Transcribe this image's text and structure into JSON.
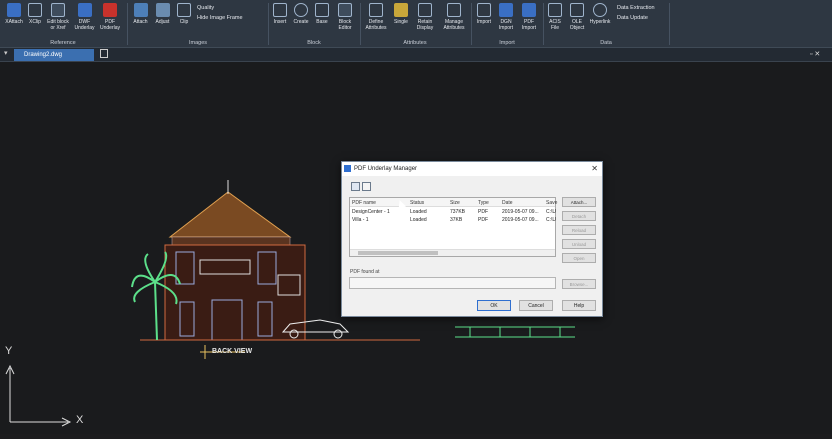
{
  "ribbon": {
    "reference": {
      "items": [
        "XAttach",
        "XClip",
        "Edit block or Xref",
        "DWF Underlay",
        "PDF Underlay"
      ],
      "label": "Reference"
    },
    "images": {
      "items": [
        "Attach",
        "Adjust",
        "Clip"
      ],
      "quality": "Quality",
      "hide_frame": "Hide Image Frame",
      "label": "Images"
    },
    "block": {
      "items": [
        "Insert",
        "Create",
        "Base",
        "Block Editor"
      ],
      "label": "Block"
    },
    "attributes": {
      "items": [
        "Define Attributes",
        "Single",
        "Retain Display",
        "Manage Attributes"
      ],
      "label": "Attributes"
    },
    "import": {
      "items": [
        "Import",
        "DGN Import",
        "PDF Import"
      ],
      "label": "Import"
    },
    "data": {
      "items": [
        "ACIS File",
        "OLE Object",
        "Hyperlink"
      ],
      "data_extraction": "Data Extraction",
      "data_update": "Data Update",
      "label": "Data"
    }
  },
  "document_tab": "Drawing2.dwg",
  "drawing": {
    "label": "BACK VIEW",
    "axis_y": "Y",
    "axis_x": "X"
  },
  "dialog": {
    "title": "PDF Underlay Manager",
    "close": "✕",
    "columns": [
      "PDF name",
      "Status",
      "Size",
      "Type",
      "Date",
      "Save"
    ],
    "rows": [
      {
        "name": "DesignCenter - 1",
        "status": "Loaded",
        "size": "737KB",
        "type": "PDF",
        "date": "2019-05-07 09...",
        "save": "C:\\U"
      },
      {
        "name": "Villa - 1",
        "status": "Loaded",
        "size": "37KB",
        "type": "PDF",
        "date": "2019-05-07 09...",
        "save": "C:\\U"
      }
    ],
    "side_buttons": [
      "Attach...",
      "Detach",
      "Reload",
      "Unload",
      "Open"
    ],
    "found_at_label": "PDF found at",
    "browse": "Browse...",
    "ok": "OK",
    "cancel": "Cancel",
    "help": "Help"
  },
  "colors": {
    "ribbon_bg": "#2e3742",
    "tab_active": "#3b6fb0",
    "canvas_bg": "#1a1b1d",
    "dialog_bg": "#f0f0f0",
    "accent": "#2f6fd0"
  }
}
